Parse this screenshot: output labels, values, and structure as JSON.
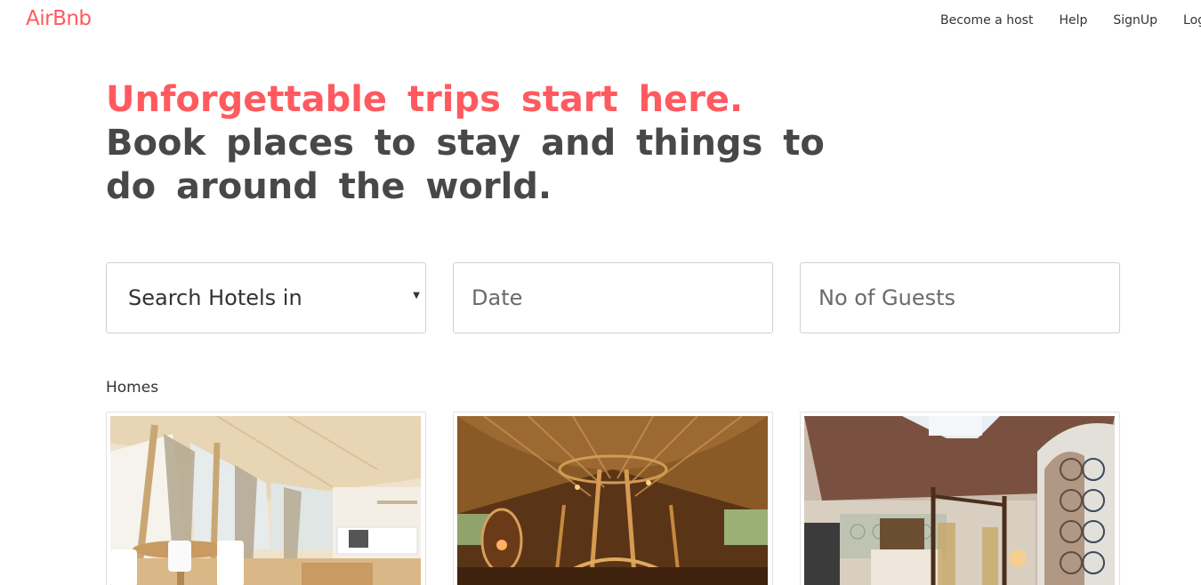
{
  "brand": {
    "name": "AirBnb",
    "color": "#ff5a5f"
  },
  "nav": {
    "items": [
      {
        "label": "Become a host"
      },
      {
        "label": "Help"
      },
      {
        "label": "SignUp"
      },
      {
        "label": "Login"
      }
    ]
  },
  "hero": {
    "highlight": "Unforgettable trips start here.",
    "text": "Book places to stay and things to do around the world."
  },
  "search": {
    "location_select": {
      "selected": "Search Hotels in"
    },
    "date": {
      "placeholder": "Date",
      "value": ""
    },
    "guests": {
      "placeholder": "No of Guests",
      "value": ""
    }
  },
  "homes": {
    "title": "Homes",
    "cards": [
      {
        "image": "bright-loft-apartment-photo"
      },
      {
        "image": "bamboo-treehouse-interior-photo"
      },
      {
        "image": "moroccan-riad-bedroom-photo"
      }
    ]
  }
}
